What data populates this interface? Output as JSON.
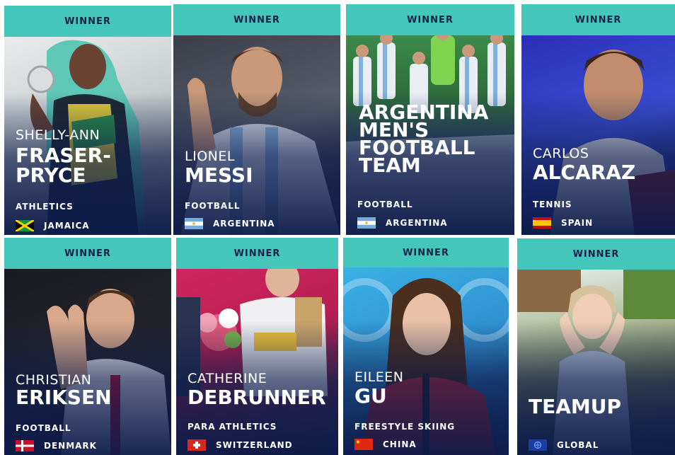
{
  "cards": [
    {
      "banner": "WINNER",
      "first_name": "SHELLY-ANN",
      "last_name_1": "FRASER-",
      "last_name_2": "PRYCE",
      "sport": "ATHLETICS",
      "country": "JAMAICA",
      "flag": "jamaica-flag-icon"
    },
    {
      "banner": "WINNER",
      "first_name": "LIONEL",
      "last_name": "MESSI",
      "sport": "FOOTBALL",
      "country": "ARGENTINA",
      "flag": "argentina-flag-icon"
    },
    {
      "banner": "WINNER",
      "team_lines": [
        "ARGENTINA",
        "MEN'S",
        "FOOTBALL",
        "TEAM"
      ],
      "sport": "FOOTBALL",
      "country": "ARGENTINA",
      "flag": "argentina-flag-icon"
    },
    {
      "banner": "WINNER",
      "first_name": "CARLOS",
      "last_name": "ALCARAZ",
      "sport": "TENNIS",
      "country": "SPAIN",
      "flag": "spain-flag-icon"
    },
    {
      "banner": "WINNER",
      "first_name": "CHRISTIAN",
      "last_name": "ERIKSEN",
      "sport": "FOOTBALL",
      "country": "DENMARK",
      "flag": "denmark-flag-icon"
    },
    {
      "banner": "WINNER",
      "first_name": "CATHERINE",
      "last_name": "DEBRUNNER",
      "sport": "PARA ATHLETICS",
      "country": "SWITZERLAND",
      "flag": "switzerland-flag-icon"
    },
    {
      "banner": "WINNER",
      "first_name": "EILEEN",
      "last_name": "GU",
      "sport": "FREESTYLE SKIING",
      "country": "CHINA",
      "flag": "china-flag-icon"
    },
    {
      "banner": "WINNER",
      "last_name": "TEAMUP",
      "country": "GLOBAL",
      "flag": "globe-flag-icon"
    }
  ]
}
